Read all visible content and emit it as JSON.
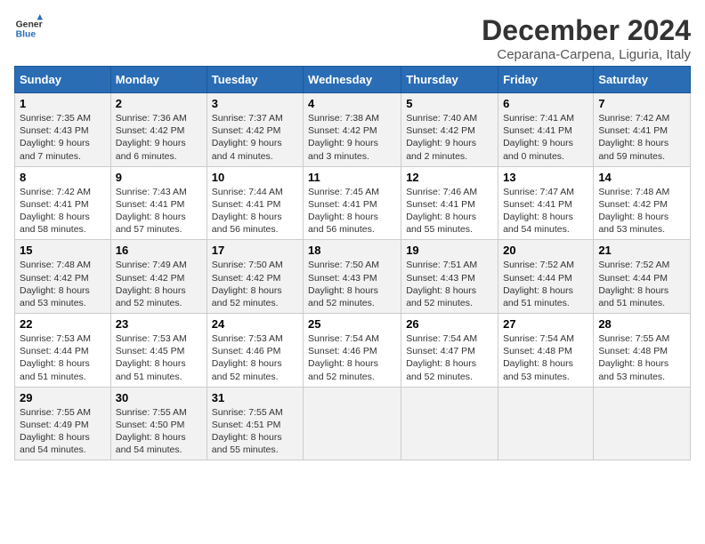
{
  "logo": {
    "line1": "General",
    "line2": "Blue"
  },
  "title": "December 2024",
  "subtitle": "Ceparana-Carpena, Liguria, Italy",
  "days_header": [
    "Sunday",
    "Monday",
    "Tuesday",
    "Wednesday",
    "Thursday",
    "Friday",
    "Saturday"
  ],
  "weeks": [
    [
      {
        "day": "1",
        "info": "Sunrise: 7:35 AM\nSunset: 4:43 PM\nDaylight: 9 hours\nand 7 minutes."
      },
      {
        "day": "2",
        "info": "Sunrise: 7:36 AM\nSunset: 4:42 PM\nDaylight: 9 hours\nand 6 minutes."
      },
      {
        "day": "3",
        "info": "Sunrise: 7:37 AM\nSunset: 4:42 PM\nDaylight: 9 hours\nand 4 minutes."
      },
      {
        "day": "4",
        "info": "Sunrise: 7:38 AM\nSunset: 4:42 PM\nDaylight: 9 hours\nand 3 minutes."
      },
      {
        "day": "5",
        "info": "Sunrise: 7:40 AM\nSunset: 4:42 PM\nDaylight: 9 hours\nand 2 minutes."
      },
      {
        "day": "6",
        "info": "Sunrise: 7:41 AM\nSunset: 4:41 PM\nDaylight: 9 hours\nand 0 minutes."
      },
      {
        "day": "7",
        "info": "Sunrise: 7:42 AM\nSunset: 4:41 PM\nDaylight: 8 hours\nand 59 minutes."
      }
    ],
    [
      {
        "day": "8",
        "info": "Sunrise: 7:42 AM\nSunset: 4:41 PM\nDaylight: 8 hours\nand 58 minutes."
      },
      {
        "day": "9",
        "info": "Sunrise: 7:43 AM\nSunset: 4:41 PM\nDaylight: 8 hours\nand 57 minutes."
      },
      {
        "day": "10",
        "info": "Sunrise: 7:44 AM\nSunset: 4:41 PM\nDaylight: 8 hours\nand 56 minutes."
      },
      {
        "day": "11",
        "info": "Sunrise: 7:45 AM\nSunset: 4:41 PM\nDaylight: 8 hours\nand 56 minutes."
      },
      {
        "day": "12",
        "info": "Sunrise: 7:46 AM\nSunset: 4:41 PM\nDaylight: 8 hours\nand 55 minutes."
      },
      {
        "day": "13",
        "info": "Sunrise: 7:47 AM\nSunset: 4:41 PM\nDaylight: 8 hours\nand 54 minutes."
      },
      {
        "day": "14",
        "info": "Sunrise: 7:48 AM\nSunset: 4:42 PM\nDaylight: 8 hours\nand 53 minutes."
      }
    ],
    [
      {
        "day": "15",
        "info": "Sunrise: 7:48 AM\nSunset: 4:42 PM\nDaylight: 8 hours\nand 53 minutes."
      },
      {
        "day": "16",
        "info": "Sunrise: 7:49 AM\nSunset: 4:42 PM\nDaylight: 8 hours\nand 52 minutes."
      },
      {
        "day": "17",
        "info": "Sunrise: 7:50 AM\nSunset: 4:42 PM\nDaylight: 8 hours\nand 52 minutes."
      },
      {
        "day": "18",
        "info": "Sunrise: 7:50 AM\nSunset: 4:43 PM\nDaylight: 8 hours\nand 52 minutes."
      },
      {
        "day": "19",
        "info": "Sunrise: 7:51 AM\nSunset: 4:43 PM\nDaylight: 8 hours\nand 52 minutes."
      },
      {
        "day": "20",
        "info": "Sunrise: 7:52 AM\nSunset: 4:44 PM\nDaylight: 8 hours\nand 51 minutes."
      },
      {
        "day": "21",
        "info": "Sunrise: 7:52 AM\nSunset: 4:44 PM\nDaylight: 8 hours\nand 51 minutes."
      }
    ],
    [
      {
        "day": "22",
        "info": "Sunrise: 7:53 AM\nSunset: 4:44 PM\nDaylight: 8 hours\nand 51 minutes."
      },
      {
        "day": "23",
        "info": "Sunrise: 7:53 AM\nSunset: 4:45 PM\nDaylight: 8 hours\nand 51 minutes."
      },
      {
        "day": "24",
        "info": "Sunrise: 7:53 AM\nSunset: 4:46 PM\nDaylight: 8 hours\nand 52 minutes."
      },
      {
        "day": "25",
        "info": "Sunrise: 7:54 AM\nSunset: 4:46 PM\nDaylight: 8 hours\nand 52 minutes."
      },
      {
        "day": "26",
        "info": "Sunrise: 7:54 AM\nSunset: 4:47 PM\nDaylight: 8 hours\nand 52 minutes."
      },
      {
        "day": "27",
        "info": "Sunrise: 7:54 AM\nSunset: 4:48 PM\nDaylight: 8 hours\nand 53 minutes."
      },
      {
        "day": "28",
        "info": "Sunrise: 7:55 AM\nSunset: 4:48 PM\nDaylight: 8 hours\nand 53 minutes."
      }
    ],
    [
      {
        "day": "29",
        "info": "Sunrise: 7:55 AM\nSunset: 4:49 PM\nDaylight: 8 hours\nand 54 minutes."
      },
      {
        "day": "30",
        "info": "Sunrise: 7:55 AM\nSunset: 4:50 PM\nDaylight: 8 hours\nand 54 minutes."
      },
      {
        "day": "31",
        "info": "Sunrise: 7:55 AM\nSunset: 4:51 PM\nDaylight: 8 hours\nand 55 minutes."
      },
      {
        "day": "",
        "info": ""
      },
      {
        "day": "",
        "info": ""
      },
      {
        "day": "",
        "info": ""
      },
      {
        "day": "",
        "info": ""
      }
    ]
  ]
}
